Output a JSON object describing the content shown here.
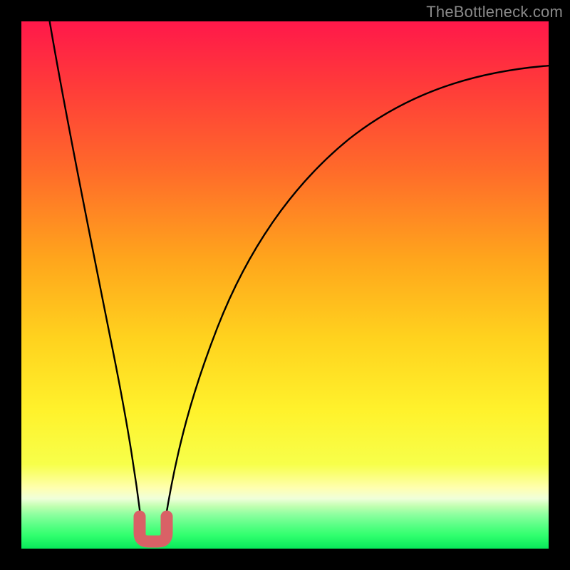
{
  "watermark": "TheBottleneck.com",
  "chart_data": {
    "type": "line",
    "title": "",
    "xlabel": "",
    "ylabel": "",
    "xlim": [
      0,
      100
    ],
    "ylim": [
      0,
      100
    ],
    "grid": false,
    "legend_position": "none",
    "notes": "Values estimated from plotted curve; x as horizontal position 0–100, y as bottleneck level 0 (bottom/green) to 100 (top/red). Minimum basin ≈ x 23–27, y ≈ 3.",
    "series": [
      {
        "name": "bottleneck-curve",
        "x": [
          5,
          8,
          11,
          14,
          17,
          20,
          23,
          24,
          25,
          26,
          27,
          30,
          33,
          37,
          42,
          48,
          55,
          63,
          72,
          82,
          92,
          100
        ],
        "values": [
          100,
          87,
          73,
          58,
          43,
          27,
          5,
          3,
          3,
          3,
          5,
          21,
          34,
          47,
          58,
          67,
          74,
          79,
          83,
          86,
          88,
          89
        ]
      }
    ],
    "gradient_colors": {
      "top": "#ff184a",
      "upper_mid": "#ff6a2a",
      "mid": "#ffd21e",
      "lower_mid": "#faff5a",
      "band_light_yellow": "#ffffb0",
      "band_pale_green": "#c0ffb0",
      "band_green1": "#6bff7a",
      "band_green2": "#35ff6a",
      "bottom": "#08e85a"
    },
    "marker": {
      "color": "#d96166",
      "shape": "U",
      "x_range": [
        22.5,
        27.5
      ],
      "y": 3,
      "stroke_width_px": 17
    },
    "curve_color": "#000000"
  }
}
